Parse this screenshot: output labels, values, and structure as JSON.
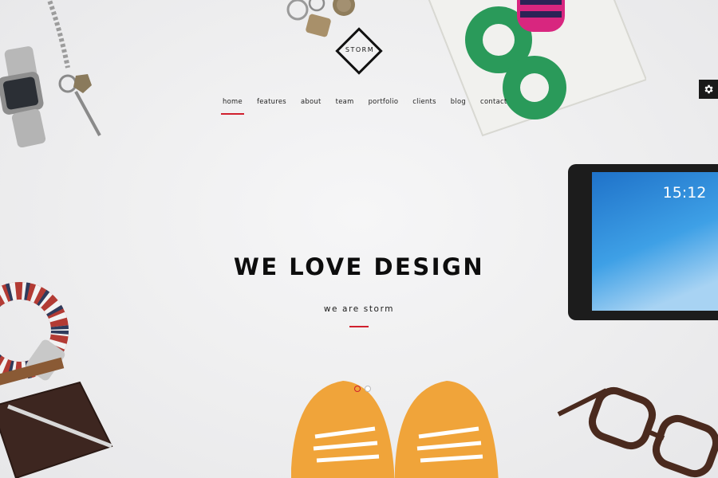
{
  "brand": {
    "logo_text": "STORM"
  },
  "nav": {
    "items": [
      {
        "label": "home",
        "active": true
      },
      {
        "label": "features",
        "active": false
      },
      {
        "label": "about",
        "active": false
      },
      {
        "label": "team",
        "active": false
      },
      {
        "label": "portfolio",
        "active": false
      },
      {
        "label": "clients",
        "active": false
      },
      {
        "label": "blog",
        "active": false
      },
      {
        "label": "contact",
        "active": false
      }
    ]
  },
  "hero": {
    "headline": "WE LOVE DESIGN",
    "subline": "we are storm"
  },
  "tablet": {
    "time": "15:12"
  },
  "slider": {
    "dot_count": 2,
    "active_index": 0
  },
  "settings": {
    "icon": "gear-icon"
  },
  "colors": {
    "accent": "#d0202e",
    "text": "#0d0d0d",
    "background": "#eeeeef"
  }
}
